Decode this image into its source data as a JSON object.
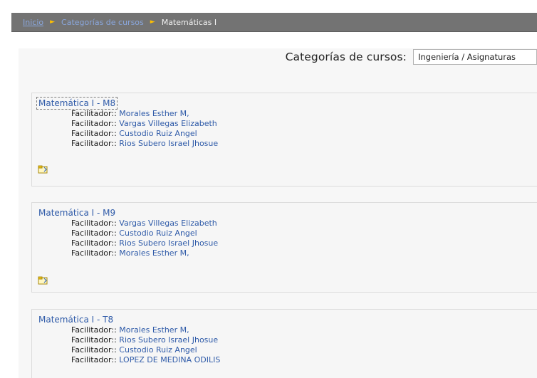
{
  "breadcrumb": {
    "items": [
      {
        "label": "Inicio"
      },
      {
        "label": "Categorías de cursos"
      },
      {
        "label": "Matemáticas I"
      }
    ],
    "separator": "►"
  },
  "category_jump": {
    "label": "Categorías de cursos:",
    "selected": "Ingeniería / Asignaturas"
  },
  "courses": [
    {
      "title": "Matemática I - M8",
      "teachers": [
        {
          "role": "Facilitador::",
          "name": "Morales Esther M,"
        },
        {
          "role": "Facilitador::",
          "name": "Vargas Villegas Elizabeth"
        },
        {
          "role": "Facilitador::",
          "name": "Custodio Ruiz Angel"
        },
        {
          "role": "Facilitador::",
          "name": "Rios Subero Israel Jhosue"
        }
      ],
      "icon": "course-summary-icon"
    },
    {
      "title": "Matemática I - M9",
      "teachers": [
        {
          "role": "Facilitador::",
          "name": "Vargas Villegas Elizabeth"
        },
        {
          "role": "Facilitador::",
          "name": "Custodio Ruiz Angel"
        },
        {
          "role": "Facilitador::",
          "name": "Rios Subero Israel Jhosue"
        },
        {
          "role": "Facilitador::",
          "name": "Morales Esther M,"
        }
      ],
      "icon": "course-summary-icon"
    },
    {
      "title": "Matemática I - T8",
      "teachers": [
        {
          "role": "Facilitador::",
          "name": "Morales Esther M,"
        },
        {
          "role": "Facilitador::",
          "name": "Rios Subero Israel Jhosue"
        },
        {
          "role": "Facilitador::",
          "name": "Custodio Ruiz Angel"
        },
        {
          "role": "Facilitador::",
          "name": "LOPEZ DE MEDINA ODILIS"
        }
      ]
    }
  ],
  "colors": {
    "navbar": "#737373",
    "link": "#2e5aa8",
    "breadcrumb_link": "#8aa7dd",
    "separator": "#ffc000"
  }
}
